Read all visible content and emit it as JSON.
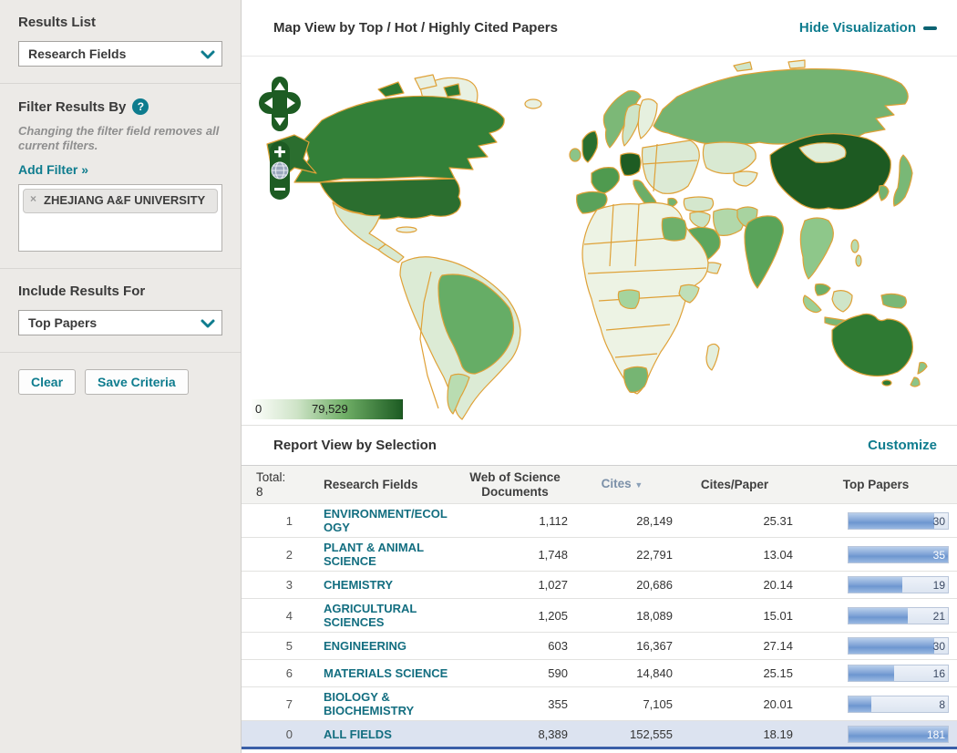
{
  "colors": {
    "accent_teal": "#0e7c8e",
    "sidebar_bg": "#eceae7",
    "map_border_gold": "#dfa137",
    "map_green_scale": [
      "#edf3e4",
      "#d8e9d1",
      "#b4d8ab",
      "#6fb06b",
      "#4f9a4f",
      "#2e7a33",
      "#1d5c23"
    ],
    "bar_blue": "#7fa3d6",
    "selected_row_bg": "#dce3f0"
  },
  "sidebar": {
    "results_list": {
      "heading": "Results List",
      "dropdown_value": "Research Fields"
    },
    "filter": {
      "heading": "Filter Results By",
      "help_glyph": "?",
      "note": "Changing the filter field removes all current filters.",
      "add_filter_label": "Add Filter »",
      "tag": {
        "remove_glyph": "×",
        "label": "ZHEJIANG A&F UNIVERSITY"
      }
    },
    "include": {
      "heading": "Include Results For",
      "dropdown_value": "Top Papers"
    },
    "buttons": {
      "clear": "Clear",
      "save": "Save Criteria"
    }
  },
  "map_panel": {
    "title": "Map View by Top / Hot / Highly Cited Papers",
    "hide_label": "Hide Visualization",
    "legend": {
      "min": "0",
      "max": "79,529"
    },
    "controls": {
      "zoom_in": "+",
      "zoom_out": "−"
    }
  },
  "report": {
    "title": "Report View by Selection",
    "customize_label": "Customize",
    "table": {
      "total_label": "Total:",
      "total_value": "8",
      "col_field": "Research Fields",
      "col_docs": "Web of Science Documents",
      "col_cites": "Cites",
      "sort_arrow": "▼",
      "col_cpp": "Cites/Paper",
      "col_top": "Top Papers",
      "rows": [
        {
          "rank": "1",
          "field": "ENVIRONMENT/ECOLOGY",
          "docs": "1,112",
          "cites": "28,149",
          "cites_per_paper": "25.31",
          "top_papers": "30",
          "bar_pct": 86,
          "selected": false
        },
        {
          "rank": "2",
          "field": "PLANT & ANIMAL SCIENCE",
          "docs": "1,748",
          "cites": "22,791",
          "cites_per_paper": "13.04",
          "top_papers": "35",
          "bar_pct": 100,
          "selected": false
        },
        {
          "rank": "3",
          "field": "CHEMISTRY",
          "docs": "1,027",
          "cites": "20,686",
          "cites_per_paper": "20.14",
          "top_papers": "19",
          "bar_pct": 54,
          "selected": false
        },
        {
          "rank": "4",
          "field": "AGRICULTURAL SCIENCES",
          "docs": "1,205",
          "cites": "18,089",
          "cites_per_paper": "15.01",
          "top_papers": "21",
          "bar_pct": 60,
          "selected": false
        },
        {
          "rank": "5",
          "field": "ENGINEERING",
          "docs": "603",
          "cites": "16,367",
          "cites_per_paper": "27.14",
          "top_papers": "30",
          "bar_pct": 86,
          "selected": false
        },
        {
          "rank": "6",
          "field": "MATERIALS SCIENCE",
          "docs": "590",
          "cites": "14,840",
          "cites_per_paper": "25.15",
          "top_papers": "16",
          "bar_pct": 46,
          "selected": false
        },
        {
          "rank": "7",
          "field": "BIOLOGY & BIOCHEMISTRY",
          "docs": "355",
          "cites": "7,105",
          "cites_per_paper": "20.01",
          "top_papers": "8",
          "bar_pct": 23,
          "selected": false
        },
        {
          "rank": "0",
          "field": "ALL FIELDS",
          "docs": "8,389",
          "cites": "152,555",
          "cites_per_paper": "18.19",
          "top_papers": "181",
          "bar_pct": 100,
          "selected": true
        }
      ]
    }
  }
}
